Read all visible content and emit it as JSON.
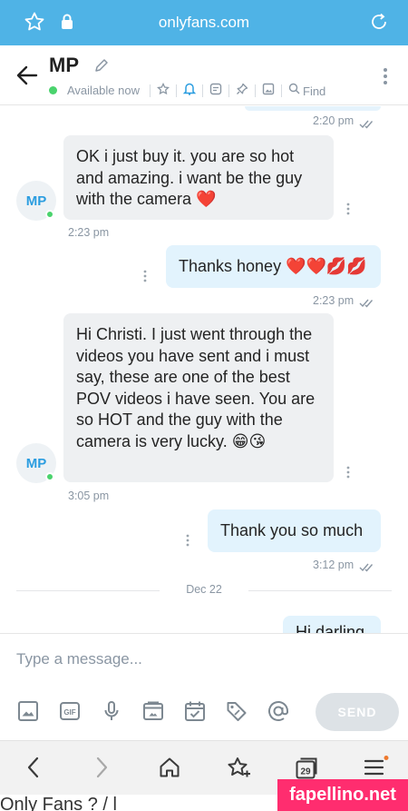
{
  "browser": {
    "url": "onlyfans.com"
  },
  "header": {
    "title": "MP",
    "status": "Available now",
    "find_label": "Find"
  },
  "messages": [
    {
      "direction": "out",
      "time": "2:20 pm",
      "read": true
    },
    {
      "direction": "in",
      "avatar": "MP",
      "text": "OK i just buy it. you are so hot and amazing. i want be the guy with the camera ❤️",
      "time": "2:23 pm"
    },
    {
      "direction": "out",
      "text": "Thanks honey ❤️❤️💋💋",
      "time": "2:23 pm",
      "read": true
    },
    {
      "direction": "in",
      "avatar": "MP",
      "text": "Hi Christi. I just went through the videos you have sent and i must say, these are one of the best POV videos i have seen. You are so HOT and the guy with the camera is very lucky. 😁😘",
      "time": "3:05 pm"
    },
    {
      "direction": "out",
      "text": "Thank you so much",
      "time": "3:12 pm",
      "read": true
    }
  ],
  "day_separator": "Dec 22",
  "partial_message": "Hi darling",
  "composer": {
    "placeholder": "Type a message...",
    "send_label": "SEND"
  },
  "browser_nav": {
    "tab_count": "29"
  },
  "watermark": "fapellino.net",
  "bottom_partial_text": "Only Fans  ? / l"
}
